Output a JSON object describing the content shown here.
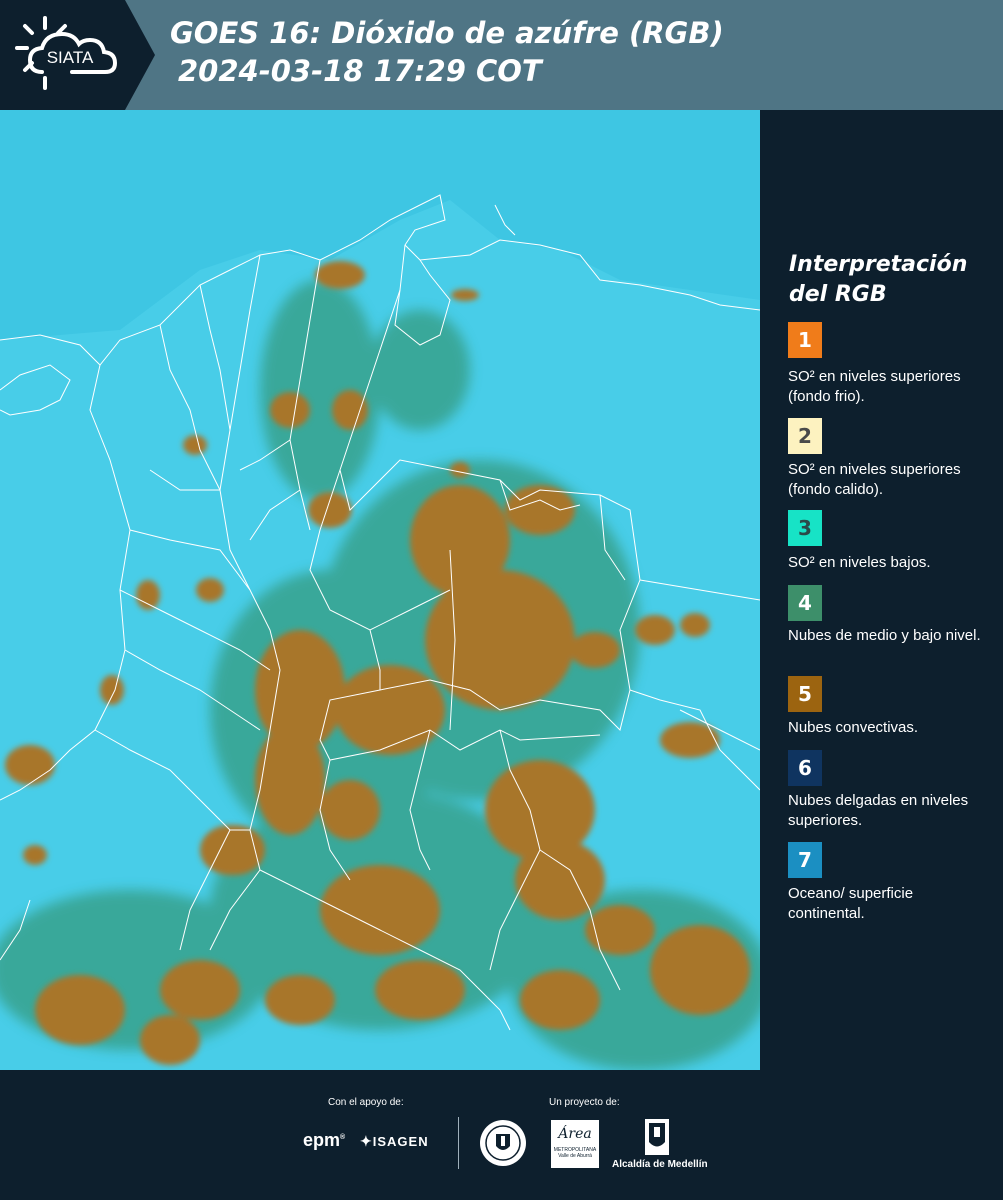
{
  "header": {
    "logo_text": "SIATA",
    "title_line1": "GOES 16: Dióxido de azúfre (RGB)",
    "title_line2": "2024-03-18 17:29 COT"
  },
  "legend": {
    "title": "Interpretación del RGB",
    "items": [
      {
        "number": "1",
        "color": "#f07c1a",
        "number_color": "#ffffff",
        "label": "SO² en niveles superiores (fondo frio)."
      },
      {
        "number": "2",
        "color": "#fdf2c0",
        "number_color": "#4a4a4a",
        "label": "SO² en niveles superiores (fondo calido)."
      },
      {
        "number": "3",
        "color": "#17e3c6",
        "number_color": "#2b4a48",
        "label": "SO² en niveles bajos."
      },
      {
        "number": "4",
        "color": "#3d8f6a",
        "number_color": "#ffffff",
        "label": "Nubes de medio y bajo nivel."
      },
      {
        "number": "5",
        "color": "#9c6410",
        "number_color": "#ffffff",
        "label": "Nubes convectivas."
      },
      {
        "number": "6",
        "color": "#0f3460",
        "number_color": "#ffffff",
        "label": "Nubes delgadas en niveles superiores."
      },
      {
        "number": "7",
        "color": "#1b8fc2",
        "number_color": "#ffffff",
        "label": "Oceano/ superficie continental."
      }
    ]
  },
  "footer": {
    "support_label": "Con el apoyo de:",
    "project_label": "Un proyecto de:",
    "support_logos": [
      "epm",
      "ISAGEN"
    ],
    "project_logos": [
      "Área Metropolitana Valle de Aburrá",
      "Alcaldía de Medellín"
    ],
    "epm_text": "epm",
    "isagen_text": "ISAGEN",
    "area_text": "Área",
    "area_sub1": "METROPOLITANA",
    "area_sub2": "Valle de Aburrá",
    "alcaldia_text": "Alcaldía de Medellín"
  },
  "map": {
    "ocean_color": "#3ec6e3",
    "land_color": "#48cde8",
    "cloud_color": "#a8762a",
    "border_color": "#ffffff"
  }
}
